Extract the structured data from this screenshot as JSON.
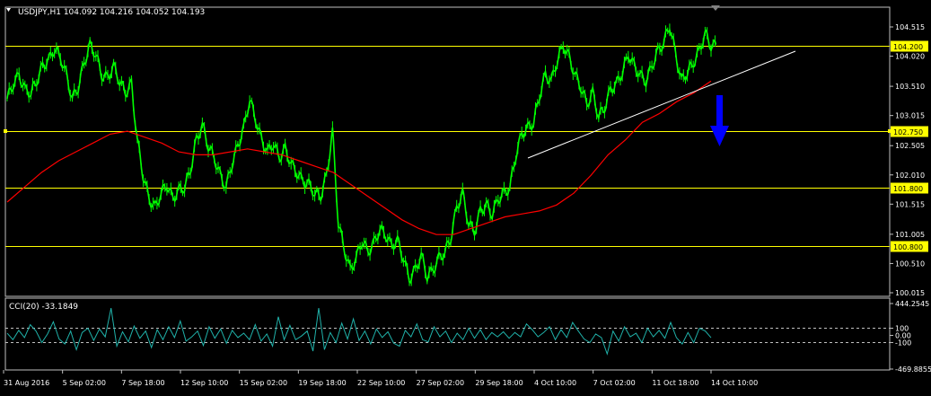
{
  "colors": {
    "background": "#000000",
    "frame": "#c0c0c0",
    "candles": "#00ff00",
    "ma": "#ff0000",
    "hline": "#ffff00",
    "trendline": "#ffffff",
    "arrow": "#0000ff",
    "cci": "#20b2aa",
    "text": "#ffffff"
  },
  "chart_data": [
    {
      "type": "line",
      "title": "USDJPY,H1  104.092 104.216 104.052 104.193",
      "x_labels": [
        "31 Aug 2016",
        "5 Sep 02:00",
        "7 Sep 18:00",
        "12 Sep 10:00",
        "15 Sep 02:00",
        "19 Sep 18:00",
        "22 Sep 10:00",
        "27 Sep 02:00",
        "29 Sep 18:00",
        "4 Oct 10:00",
        "7 Oct 02:00",
        "11 Oct 18:00",
        "14 Oct 10:00"
      ],
      "y_ticks": [
        "104.515",
        "104.020",
        "103.510",
        "103.015",
        "102.505",
        "102.010",
        "101.515",
        "101.005",
        "100.510",
        "100.015"
      ],
      "ylim": [
        100.015,
        104.515
      ],
      "grid": false,
      "series": [
        {
          "role": "price",
          "values": [
            103.3,
            103.55,
            103.7,
            103.45,
            103.4,
            103.6,
            103.85,
            103.95,
            104.15,
            104.0,
            103.7,
            103.3,
            103.5,
            103.9,
            104.2,
            104.05,
            103.7,
            103.65,
            103.85,
            103.6,
            103.4,
            103.55,
            102.6,
            102.0,
            101.6,
            101.45,
            101.7,
            101.85,
            101.6,
            101.75,
            101.8,
            102.1,
            102.6,
            102.85,
            102.5,
            102.3,
            102.0,
            101.8,
            102.2,
            102.5,
            102.8,
            103.3,
            102.95,
            102.6,
            102.4,
            102.55,
            102.3,
            102.45,
            102.2,
            102.05,
            101.9,
            101.85,
            101.7,
            101.65,
            102.0,
            102.75,
            101.2,
            100.75,
            100.4,
            100.6,
            100.9,
            100.7,
            100.85,
            101.1,
            101.0,
            100.8,
            100.9,
            100.6,
            100.25,
            100.4,
            100.65,
            100.3,
            100.4,
            100.6,
            100.7,
            100.95,
            101.45,
            101.7,
            101.2,
            101.05,
            101.4,
            101.5,
            101.35,
            101.6,
            101.7,
            101.8,
            102.35,
            102.7,
            102.8,
            102.9,
            103.35,
            103.7,
            103.6,
            103.95,
            104.2,
            104.0,
            103.7,
            103.5,
            103.2,
            103.4,
            103.0,
            103.15,
            103.45,
            103.55,
            103.75,
            104.05,
            103.85,
            103.7,
            103.6,
            103.85,
            104.1,
            104.25,
            104.55,
            104.05,
            103.6,
            103.75,
            103.9,
            104.1,
            104.4,
            104.2
          ]
        },
        {
          "role": "moving-average",
          "values": [
            101.55,
            101.8,
            102.05,
            102.25,
            102.4,
            102.55,
            102.7,
            102.75,
            102.65,
            102.55,
            102.4,
            102.35,
            102.35,
            102.4,
            102.45,
            102.4,
            102.35,
            102.25,
            102.15,
            102.05,
            101.85,
            101.65,
            101.45,
            101.25,
            101.1,
            101.0,
            101.0,
            101.1,
            101.2,
            101.3,
            101.35,
            101.4,
            101.5,
            101.7,
            102.0,
            102.35,
            102.6,
            102.9,
            103.05,
            103.25,
            103.4,
            103.6
          ]
        }
      ],
      "levels": [
        "104.200",
        "102.750",
        "101.800",
        "100.800"
      ]
    },
    {
      "type": "line",
      "title": "CCI(20) -33.1849",
      "y_ticks": [
        "444.2545",
        "100",
        "0.00",
        "-100",
        "-469.8855"
      ],
      "ylim": [
        -469.8855,
        444.2545
      ],
      "series": [
        {
          "role": "cci",
          "values": [
            30,
            -60,
            70,
            -30,
            150,
            60,
            -100,
            20,
            190,
            -50,
            -120,
            60,
            -200,
            40,
            100,
            -70,
            90,
            -20,
            380,
            -150,
            50,
            -90,
            130,
            -40,
            60,
            -170,
            80,
            -60,
            120,
            -30,
            200,
            -80,
            -20,
            60,
            -140,
            120,
            -40,
            90,
            -110,
            70,
            -30,
            30,
            -60,
            150,
            -80,
            20,
            -150,
            260,
            -60,
            140,
            -60,
            -10,
            60,
            -220,
            380,
            -200,
            40,
            -100,
            170,
            -50,
            230,
            -70,
            60,
            -120,
            90,
            -30,
            50,
            -110,
            -150,
            70,
            -20,
            160,
            -60,
            -90,
            120,
            -20,
            60,
            -100,
            30,
            -60,
            100,
            -40,
            80,
            -60,
            40,
            -20,
            50,
            -40,
            40,
            -20,
            160,
            80,
            -20,
            40,
            120,
            -60,
            80,
            -30,
            180,
            60,
            -50,
            -100,
            20,
            -30,
            -260,
            60,
            -80,
            120,
            -20,
            30,
            -100,
            100,
            -20,
            70,
            -40,
            180,
            -30,
            -120,
            40,
            -100,
            100,
            60,
            -33
          ]
        }
      ]
    }
  ]
}
